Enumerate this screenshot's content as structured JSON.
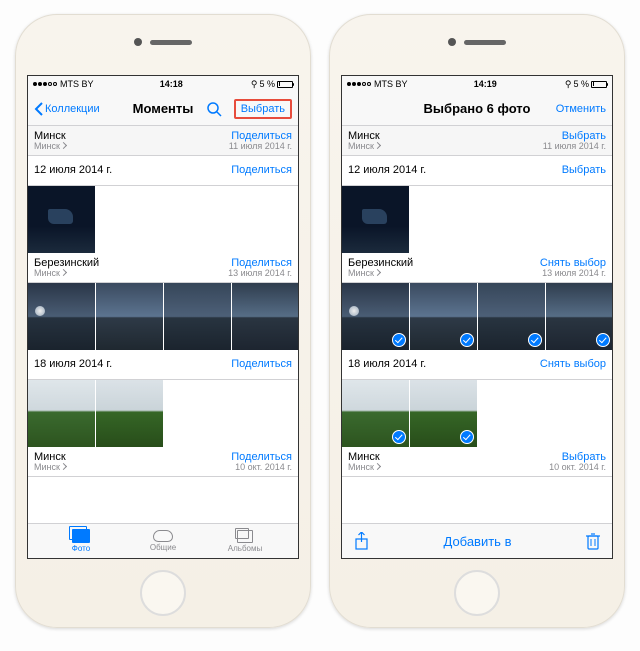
{
  "left": {
    "status": {
      "carrier": "MTS BY",
      "time": "14:18",
      "pct": "5 %"
    },
    "nav": {
      "back": "Коллекции",
      "title": "Моменты",
      "select": "Выбрать"
    },
    "sections": [
      {
        "loc": "Минск",
        "sub": "Минск",
        "action": "Поделиться",
        "date": "11 июля 2014 г.",
        "gray": true,
        "thumbs": []
      },
      {
        "loc": "12 июля 2014 г.",
        "sub": "",
        "action": "Поделиться",
        "date": "",
        "thumbs": [
          "t-dark"
        ]
      },
      {
        "loc": "Березинский",
        "sub": "Минск",
        "action": "Поделиться",
        "date": "13 июля 2014 г.",
        "thumbs": [
          "t-lake1",
          "t-lake2",
          "t-lake3",
          "t-lake4"
        ]
      },
      {
        "loc": "18 июля 2014 г.",
        "sub": "",
        "action": "Поделиться",
        "date": "",
        "thumbs": [
          "t-field1",
          "t-field2"
        ]
      },
      {
        "loc": "Минск",
        "sub": "Минск",
        "action": "Поделиться",
        "date": "10 окт. 2014 г.",
        "thumbs": []
      }
    ],
    "tabs": {
      "photos": "Фото",
      "shared": "Общие",
      "albums": "Альбомы"
    }
  },
  "right": {
    "status": {
      "carrier": "MTS BY",
      "time": "14:19",
      "pct": "5 %"
    },
    "nav": {
      "title": "Выбрано 6 фото",
      "cancel": "Отменить"
    },
    "sections": [
      {
        "loc": "Минск",
        "sub": "Минск",
        "action": "Выбрать",
        "date": "11 июля 2014 г.",
        "gray": true,
        "thumbs": []
      },
      {
        "loc": "12 июля 2014 г.",
        "sub": "",
        "action": "Выбрать",
        "date": "",
        "thumbs": [
          "t-dark"
        ]
      },
      {
        "loc": "Березинский",
        "sub": "Минск",
        "action": "Снять выбор",
        "date": "13 июля 2014 г.",
        "thumbs": [
          "t-lake1",
          "t-lake2",
          "t-lake3",
          "t-lake4"
        ],
        "selected": true
      },
      {
        "loc": "18 июля 2014 г.",
        "sub": "",
        "action": "Снять выбор",
        "date": "",
        "thumbs": [
          "t-field1",
          "t-field2"
        ],
        "selected": true
      },
      {
        "loc": "Минск",
        "sub": "Минск",
        "action": "Выбрать",
        "date": "10 окт. 2014 г.",
        "thumbs": []
      }
    ],
    "toolbar": {
      "add": "Добавить в"
    }
  }
}
